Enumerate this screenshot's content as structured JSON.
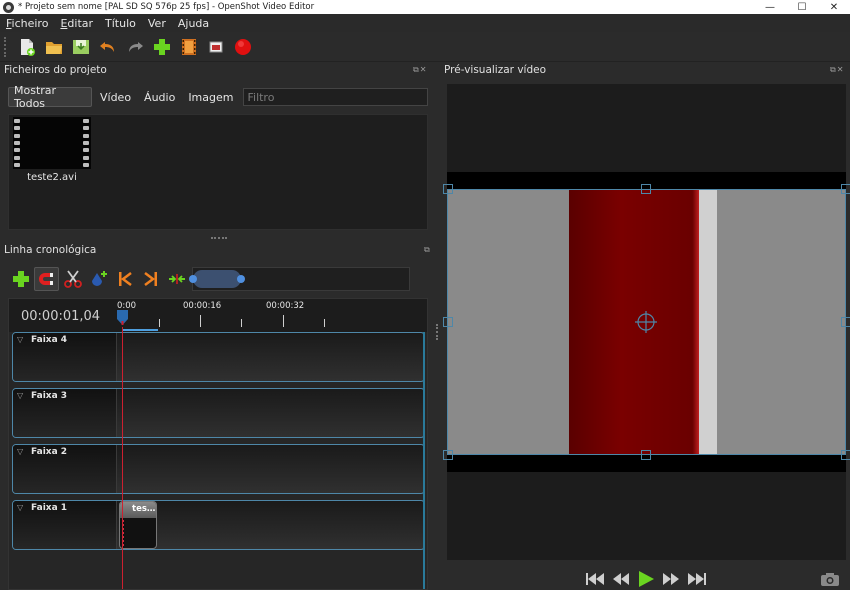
{
  "window": {
    "title": "* Projeto sem nome [PAL SD SQ 576p 25 fps] - OpenShot Video Editor",
    "controls": {
      "minimize": "—",
      "maximize": "☐",
      "close": "✕"
    }
  },
  "menu": {
    "items": [
      {
        "label": "Ficheiro",
        "accel_letter": "F",
        "rest": "icheiro"
      },
      {
        "label": "Editar",
        "accel_letter": "E",
        "rest": "ditar"
      },
      {
        "label": "Título",
        "accel_letter": "T",
        "rest": "ítulo"
      },
      {
        "label": "Ver",
        "accel_letter": "V",
        "rest": "er"
      },
      {
        "label": "Ajuda",
        "accel_letter": "A",
        "rest": "juda"
      }
    ]
  },
  "toolbar": {
    "icons": [
      "new-project-icon",
      "open-project-icon",
      "save-project-icon",
      "undo-icon",
      "redo-icon",
      "import-files-icon",
      "choose-profile-icon",
      "fullscreen-icon",
      "export-video-icon"
    ]
  },
  "project_files": {
    "title": "Ficheiros do projeto",
    "tabs": [
      "Mostrar Todos",
      "Vídeo",
      "Áudio",
      "Imagem"
    ],
    "active_tab": "Mostrar Todos",
    "filter_placeholder": "Filtro",
    "files": [
      {
        "name": "teste2.avi"
      }
    ]
  },
  "timeline": {
    "title": "Linha cronológica",
    "timecode": "00:00:01,04",
    "ruler_labels": [
      "0:00",
      "00:00:16",
      "00:00:32"
    ],
    "tracks": [
      {
        "name": "Faixa 4",
        "clips": []
      },
      {
        "name": "Faixa 3",
        "clips": []
      },
      {
        "name": "Faixa 2",
        "clips": []
      },
      {
        "name": "Faixa 1",
        "clips": [
          {
            "title": "tes…"
          }
        ]
      }
    ],
    "tools": [
      "add-track-icon",
      "snapping-icon",
      "razor-icon",
      "add-marker-icon",
      "previous-marker-icon",
      "next-marker-icon",
      "center-playhead-icon"
    ]
  },
  "preview": {
    "title": "Pré-visualizar vídeo",
    "controls": [
      "jump-start-icon",
      "rewind-icon",
      "play-icon",
      "fast-forward-icon",
      "jump-end-icon",
      "camera-icon"
    ]
  },
  "colors": {
    "background": "#2b2b2b",
    "panel_dark": "#1e1e1e",
    "accent_blue": "#4e87a8",
    "playhead_red": "#cc2030",
    "record_red": "#e01010",
    "add_green": "#6ad420"
  }
}
